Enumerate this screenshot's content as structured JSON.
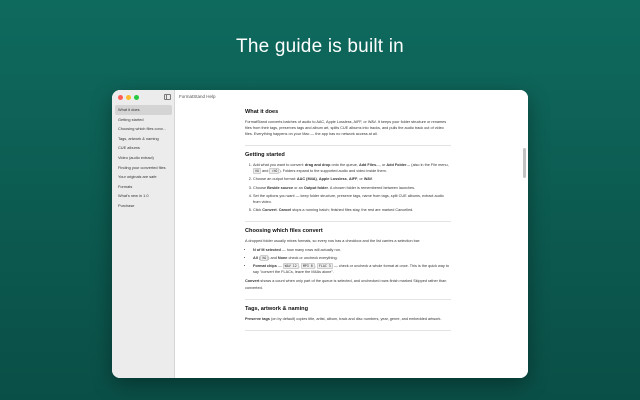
{
  "hero": {
    "title": "The guide is built in"
  },
  "window": {
    "title": "FormatStand Help",
    "sidebar": {
      "items": [
        {
          "label": "What it does",
          "active": true
        },
        {
          "label": "Getting started"
        },
        {
          "label": "Choosing which files conv..."
        },
        {
          "label": "Tags, artwork & naming"
        },
        {
          "label": "CUE albums"
        },
        {
          "label": "Video (audio extract)"
        },
        {
          "label": "Finding your converted files"
        },
        {
          "label": "Your originals are safe"
        },
        {
          "label": "Formats"
        },
        {
          "label": "What's new in 1.0"
        },
        {
          "label": "Purchase"
        }
      ]
    },
    "sections": {
      "what": {
        "heading": "What it does",
        "body": "FormatStand converts batches of audio to AAC, Apple Lossless, AIFF, or WAV. It keeps your folder structure or renames files from their tags, preserves tags and album art, splits CUE albums into tracks, and pulls the audio track out of video files. Everything happens on your Mac — the app has no network access at all."
      },
      "start": {
        "heading": "Getting started",
        "step1": {
          "a": "Add what you want to convert: ",
          "b": "drag and drop",
          "c": " onto the queue, ",
          "d": "Add Files…",
          "e": ", or ",
          "f": "Add Folder…",
          "g": " (also in the File menu, ",
          "k1": "⌘O",
          "h": " and ",
          "k2": "⇧⌘O",
          "i": "). Folders expand to the supported audio and video inside them."
        },
        "step2": {
          "a": "Choose an output format: ",
          "b": "AAC (M4A)",
          "c": ", ",
          "d": "Apple Lossless",
          "e": ", ",
          "f": "AIFF",
          "g": ", or ",
          "h": "WAV",
          "i": "."
        },
        "step3": {
          "a": "Choose ",
          "b": "Beside source",
          "c": " or an ",
          "d": "Output folder",
          "e": ". A chosen folder is remembered between launches."
        },
        "step4": "Set the options you want — keep folder structure, preserve tags, name from tags, split CUE albums, extract audio from video.",
        "step5": {
          "a": "Click ",
          "b": "Convert",
          "c": ". ",
          "d": "Cancel",
          "e": " stops a running batch; finished files stay, the rest are marked Cancelled."
        }
      },
      "choose": {
        "heading": "Choosing which files convert",
        "intro": "A dropped folder usually mixes formats, so every row has a checkbox and the list carries a selection bar:",
        "b1": {
          "a": "N of M selected",
          "b": " — how many rows will actually run."
        },
        "b2": {
          "a": "All",
          "b": " (",
          "k": "⌘A",
          "c": ") and ",
          "d": "None",
          "e": " check or uncheck everything."
        },
        "b3": {
          "a": "Format chips",
          "b": " — ",
          "k1": "WAV 12",
          "c": ", ",
          "k2": "MP3 8",
          "d": ", ",
          "k3": "FLAC 3",
          "e": " — check or uncheck a whole format at once. This is the quick way to say \"convert the FLACs, leave the M4As alone\"."
        },
        "foot": {
          "a": "Convert",
          "b": " shows a count when only part of the queue is selected, and unchecked rows finish marked Skipped rather than converted."
        }
      },
      "tags": {
        "heading": "Tags, artwork & naming",
        "body": {
          "a": "Preserve tags",
          "b": " (on by default) copies title, artist, album, track and disc numbers, year, genre, and embedded artwork."
        }
      }
    }
  }
}
